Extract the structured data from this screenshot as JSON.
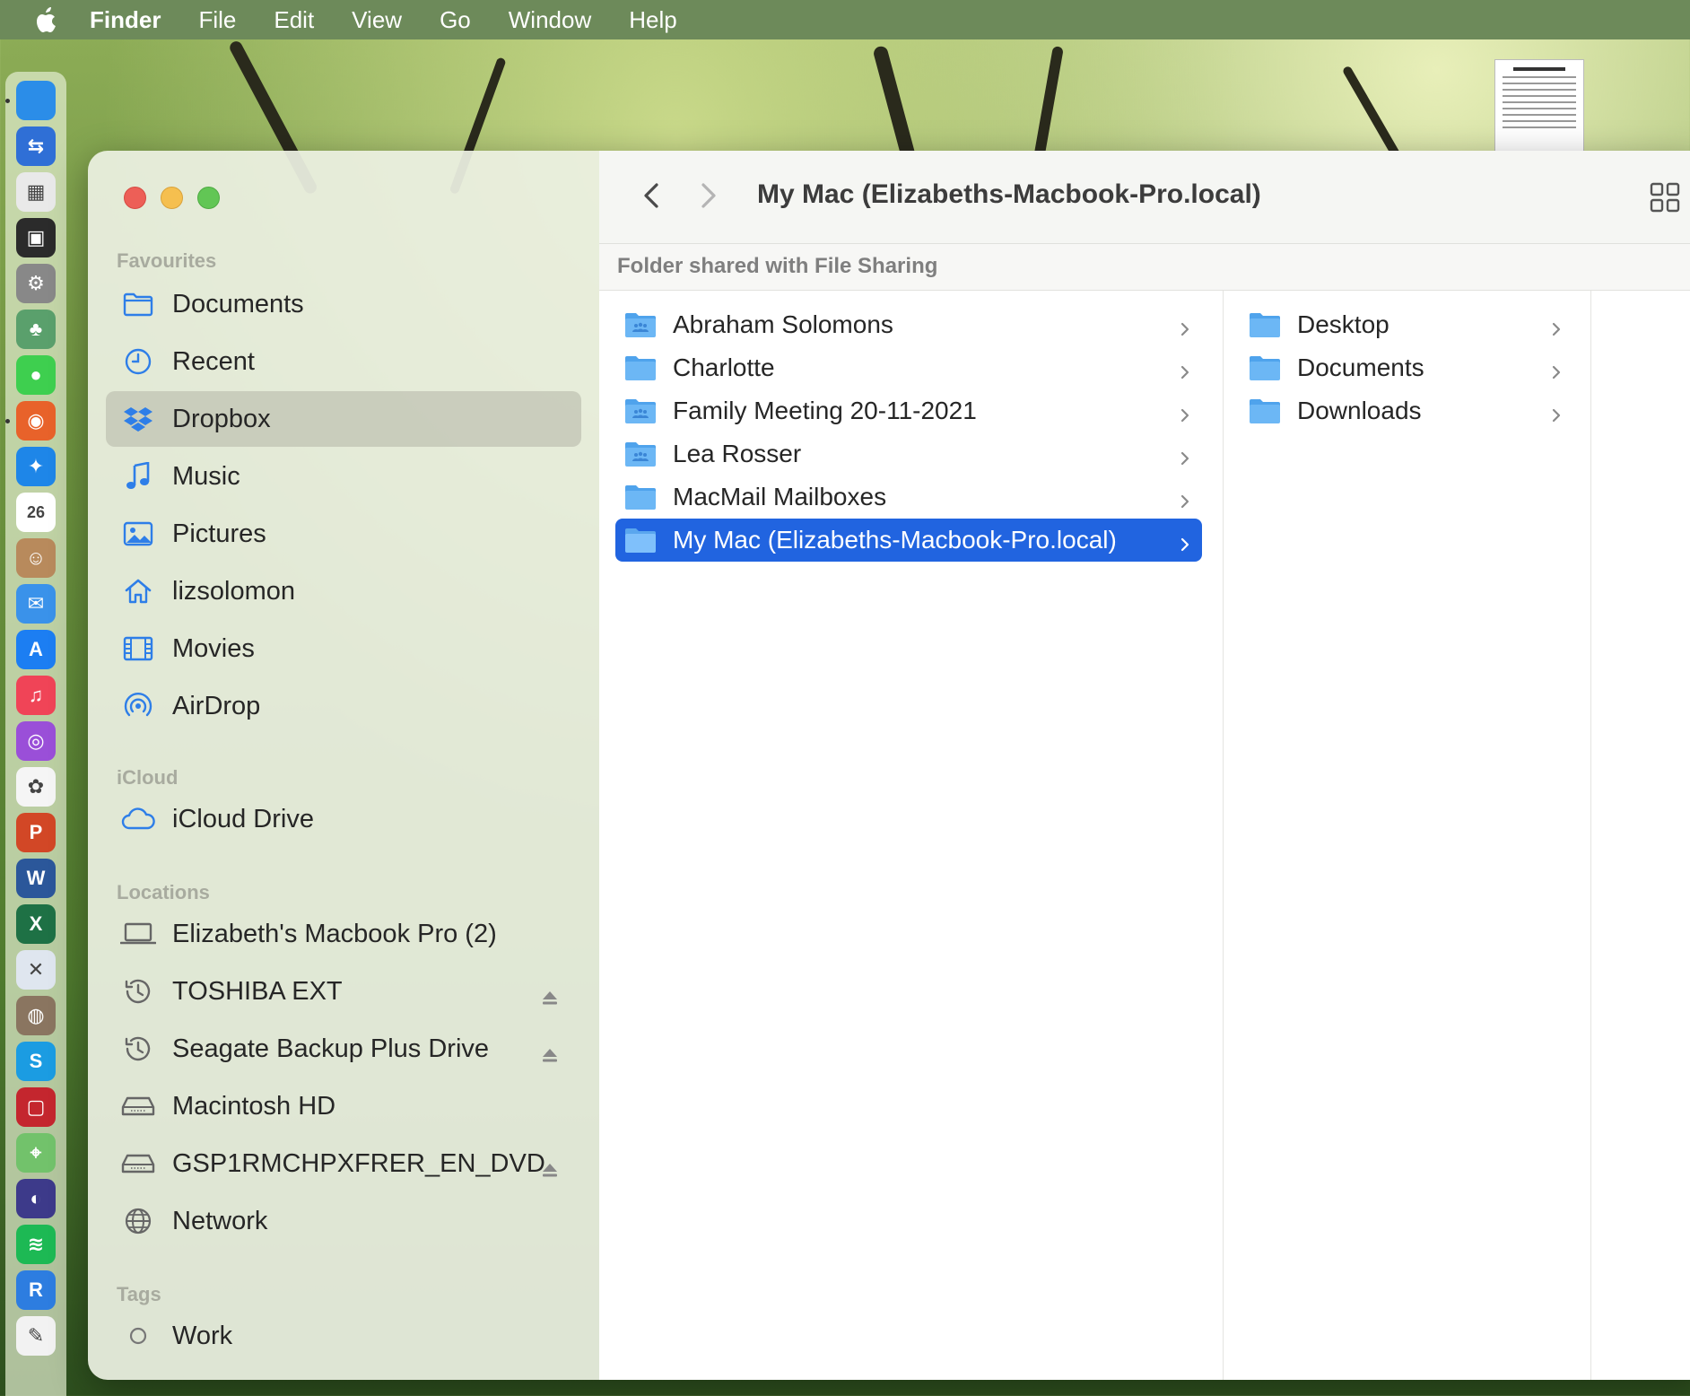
{
  "menubar": {
    "app": "Finder",
    "items": [
      "File",
      "Edit",
      "View",
      "Go",
      "Window",
      "Help"
    ]
  },
  "dock": {
    "icons": [
      {
        "name": "finder",
        "color": "#2b8de8",
        "glyph": ""
      },
      {
        "name": "migration",
        "color": "#2f6fd6",
        "glyph": "⇆"
      },
      {
        "name": "launchpad",
        "color": "#e9e9e9",
        "glyph": "▦"
      },
      {
        "name": "mission-control",
        "color": "#2b2b2b",
        "glyph": "▣"
      },
      {
        "name": "system-preferences",
        "color": "#888888",
        "glyph": "⚙"
      },
      {
        "name": "family-tree",
        "color": "#5aa06c",
        "glyph": "♣"
      },
      {
        "name": "messages",
        "color": "#3ecf4f",
        "glyph": "●"
      },
      {
        "name": "firefox",
        "color": "#e8622a",
        "glyph": "◉"
      },
      {
        "name": "safari",
        "color": "#1e86e8",
        "glyph": "✦"
      },
      {
        "name": "calendar",
        "color": "#ffffff",
        "glyph": "26"
      },
      {
        "name": "contacts",
        "color": "#b88a5c",
        "glyph": "☺"
      },
      {
        "name": "mail",
        "color": "#3a92ea",
        "glyph": "✉"
      },
      {
        "name": "app-store",
        "color": "#1c7ef2",
        "glyph": "A"
      },
      {
        "name": "music",
        "color": "#f04457",
        "glyph": "♫"
      },
      {
        "name": "podcasts",
        "color": "#9a4fd8",
        "glyph": "◎"
      },
      {
        "name": "photos",
        "color": "#f5f5f5",
        "glyph": "✿"
      },
      {
        "name": "powerpoint",
        "color": "#d24726",
        "glyph": "P"
      },
      {
        "name": "word",
        "color": "#2b579a",
        "glyph": "W"
      },
      {
        "name": "excel",
        "color": "#1e7145",
        "glyph": "X"
      },
      {
        "name": "x-app",
        "color": "#dfe6ef",
        "glyph": "✕"
      },
      {
        "name": "disk-utility",
        "color": "#8a7560",
        "glyph": "◍"
      },
      {
        "name": "skype",
        "color": "#1b9ce2",
        "glyph": "S"
      },
      {
        "name": "photo-booth",
        "color": "#c4262e",
        "glyph": "▢"
      },
      {
        "name": "maps",
        "color": "#72c26b",
        "glyph": "⌖"
      },
      {
        "name": "siri",
        "color": "#3d3a8a",
        "glyph": "◐"
      },
      {
        "name": "spotify",
        "color": "#1db954",
        "glyph": "≋"
      },
      {
        "name": "r-app",
        "color": "#2d7de0",
        "glyph": "R"
      },
      {
        "name": "textedit",
        "color": "#f2f2f2",
        "glyph": "✎"
      }
    ]
  },
  "sidebar": {
    "favourites_label": "Favourites",
    "favourites": [
      {
        "label": "Documents",
        "icon": "folder-icon"
      },
      {
        "label": "Recent",
        "icon": "clock-icon"
      },
      {
        "label": "Dropbox",
        "icon": "dropbox-icon",
        "selected": true
      },
      {
        "label": "Music",
        "icon": "music-note-icon"
      },
      {
        "label": "Pictures",
        "icon": "pictures-icon"
      },
      {
        "label": "lizsolomon",
        "icon": "home-icon"
      },
      {
        "label": "Movies",
        "icon": "film-icon"
      },
      {
        "label": "AirDrop",
        "icon": "airdrop-icon"
      }
    ],
    "icloud_label": "iCloud",
    "icloud": [
      {
        "label": "iCloud Drive",
        "icon": "cloud-icon"
      }
    ],
    "locations_label": "Locations",
    "locations": [
      {
        "label": "Elizabeth's Macbook Pro (2)",
        "icon": "laptop-icon",
        "eject": false
      },
      {
        "label": "TOSHIBA EXT",
        "icon": "time-machine-icon",
        "eject": true
      },
      {
        "label": "Seagate Backup Plus Drive",
        "icon": "time-machine-icon",
        "eject": true
      },
      {
        "label": "Macintosh HD",
        "icon": "hard-drive-icon",
        "eject": false
      },
      {
        "label": "GSP1RMCHPXFRER_EN_DVD",
        "icon": "hard-drive-icon",
        "eject": true
      },
      {
        "label": "Network",
        "icon": "globe-icon",
        "eject": false
      }
    ],
    "tags_label": "Tags",
    "tags": [
      {
        "label": "Work",
        "icon": "tag-circle-icon"
      }
    ]
  },
  "toolbar": {
    "title": "My Mac (Elizabeths-Macbook-Pro.local)"
  },
  "pathbar": {
    "text": "Folder shared with File Sharing"
  },
  "column1": [
    {
      "label": "Abraham Solomons",
      "shared": true,
      "selected": false
    },
    {
      "label": "Charlotte",
      "shared": false,
      "selected": false
    },
    {
      "label": "Family Meeting 20-11-2021",
      "shared": true,
      "selected": false
    },
    {
      "label": "Lea Rosser",
      "shared": true,
      "selected": false
    },
    {
      "label": "MacMail Mailboxes",
      "shared": false,
      "selected": false
    },
    {
      "label": "My Mac (Elizabeths-Macbook-Pro.local)",
      "shared": false,
      "selected": true
    }
  ],
  "column2": [
    {
      "label": "Desktop"
    },
    {
      "label": "Documents"
    },
    {
      "label": "Downloads"
    }
  ],
  "colors": {
    "selection": "#2164e0",
    "folder": "#64b5f6",
    "sidebar_icon": "#2e7ee8"
  }
}
